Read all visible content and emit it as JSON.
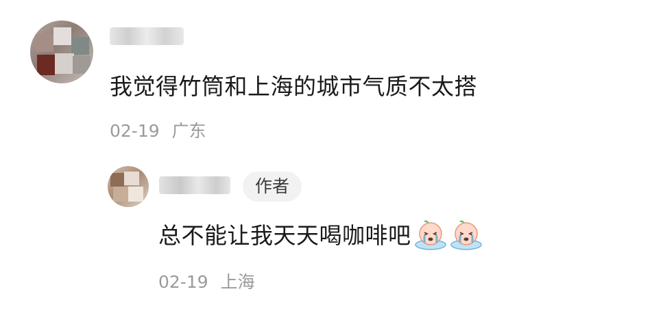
{
  "main_comment": {
    "text": "我觉得竹筒和上海的城市气质不太搭",
    "date": "02-19",
    "location": "广东"
  },
  "reply": {
    "author_badge": "作者",
    "text": "总不能让我天天喝咖啡吧",
    "emojis": [
      "crying-face-emoji",
      "crying-face-emoji"
    ],
    "date": "02-19",
    "location": "上海"
  },
  "colors": {
    "text_primary": "#1a1a1a",
    "text_meta": "#9a9a9a",
    "badge_bg": "#f2f2f2"
  }
}
